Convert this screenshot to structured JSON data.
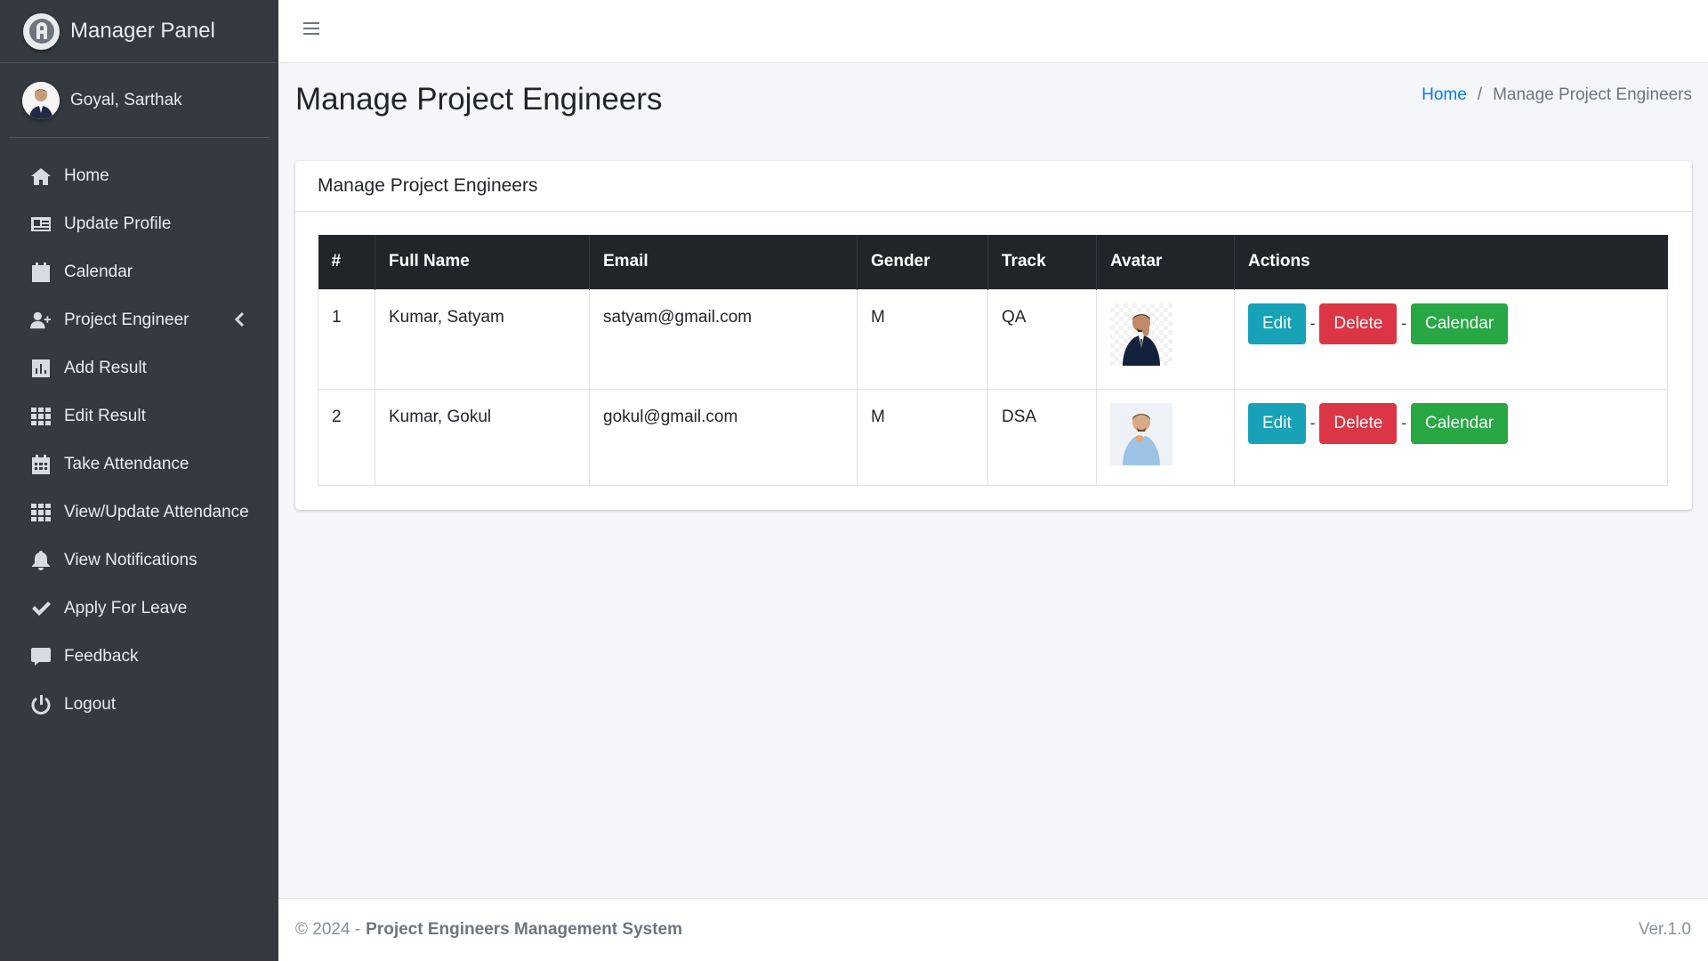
{
  "brand": {
    "title": "Manager Panel"
  },
  "user": {
    "name": "Goyal, Sarthak"
  },
  "sidebar": {
    "items": [
      {
        "label": "Home",
        "icon": "home-icon"
      },
      {
        "label": "Update Profile",
        "icon": "id-card-icon"
      },
      {
        "label": "Calendar",
        "icon": "calendar-icon"
      },
      {
        "label": "Project Engineer",
        "icon": "user-plus-icon"
      },
      {
        "label": "Add Result",
        "icon": "bar-chart-icon"
      },
      {
        "label": "Edit Result",
        "icon": "grid-icon"
      },
      {
        "label": "Take Attendance",
        "icon": "calendar-grid-icon"
      },
      {
        "label": "View/Update Attendance",
        "icon": "grid-icon"
      },
      {
        "label": "View Notifications",
        "icon": "bell-icon"
      },
      {
        "label": "Apply For Leave",
        "icon": "check-icon"
      },
      {
        "label": "Feedback",
        "icon": "comment-icon"
      },
      {
        "label": "Logout",
        "icon": "power-icon"
      }
    ]
  },
  "page": {
    "title": "Manage Project Engineers",
    "breadcrumb": {
      "home": "Home",
      "separator": "/",
      "current": "Manage Project Engineers"
    }
  },
  "card": {
    "title": "Manage Project Engineers"
  },
  "table": {
    "headers": [
      "#",
      "Full Name",
      "Email",
      "Gender",
      "Track",
      "Avatar",
      "Actions"
    ],
    "rows": [
      {
        "index": "1",
        "name": "Kumar, Satyam",
        "email": "satyam@gmail.com",
        "gender": "M",
        "track": "QA"
      },
      {
        "index": "2",
        "name": "Kumar, Gokul",
        "email": "gokul@gmail.com",
        "gender": "M",
        "track": "DSA"
      }
    ],
    "actions": {
      "edit": "Edit",
      "delete": "Delete",
      "calendar": "Calendar",
      "separator": "-"
    }
  },
  "footer": {
    "copyright": "© 2024 -",
    "system_name": "Project Engineers Management System",
    "version": "Ver.1.0"
  },
  "colors": {
    "sidebar_bg": "#343a40",
    "table_header_bg": "#212529",
    "edit": "#17a2b8",
    "delete": "#dc3545",
    "calendar": "#28a745",
    "link": "#007bff"
  }
}
